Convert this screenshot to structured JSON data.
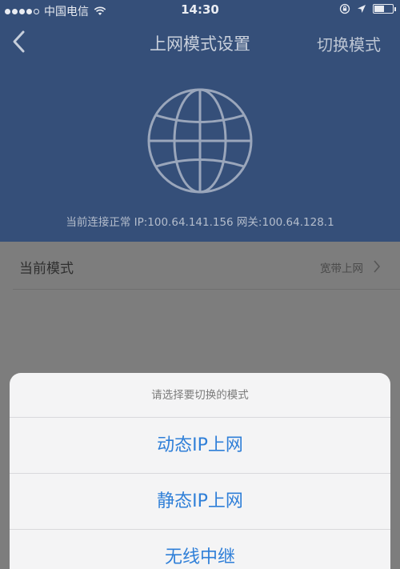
{
  "status_bar": {
    "carrier": "中国电信",
    "time": "14:30",
    "battery_level": 0.55,
    "icons": [
      "wifi-icon",
      "rotation-lock-icon",
      "location-arrow-icon",
      "battery-icon"
    ]
  },
  "nav": {
    "title": "上网模式设置",
    "right_action": "切换模式"
  },
  "connection": {
    "info": "当前连接正常 IP:100.64.141.156 网关:100.64.128.1"
  },
  "current_mode": {
    "label": "当前模式",
    "value": "宽带上网"
  },
  "sheet": {
    "title": "请选择要切换的模式",
    "options": [
      "动态IP上网",
      "静态IP上网",
      "无线中继"
    ]
  },
  "colors": {
    "header_bg": "#354f79",
    "overlay_bg": "#7d7d7d",
    "option_text": "#2f7fd8"
  }
}
